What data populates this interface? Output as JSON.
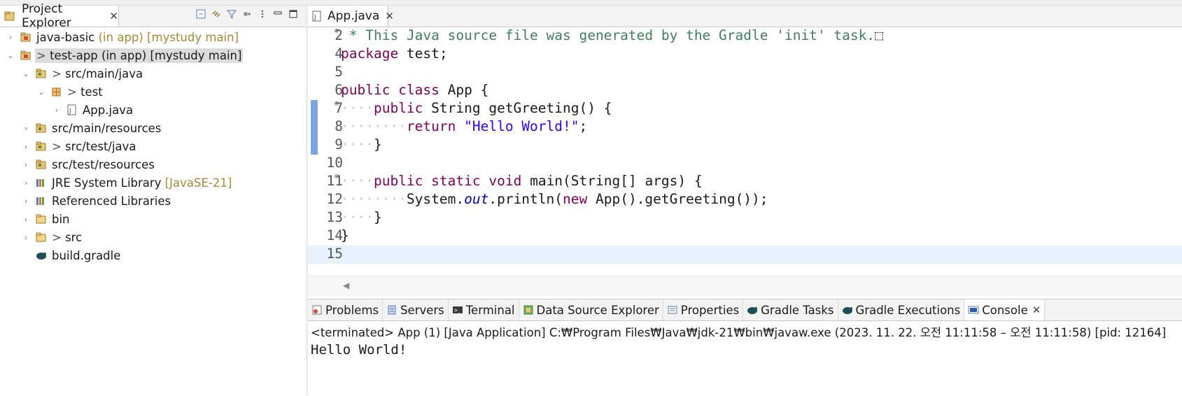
{
  "explorer": {
    "tab_label": "Project Explorer",
    "close": "✕",
    "tools": [
      "collapse-all-icon",
      "link-editor-icon",
      "filter-icon",
      "focus-icon",
      "view-menu-icon",
      "minimize-icon",
      "maximize-icon"
    ],
    "items": [
      {
        "twisty": "›",
        "icon": "project-icon",
        "prefix": "",
        "name": "java-basic",
        "decoration": " (in app) [mystudy main]",
        "selected": false
      },
      {
        "twisty": "⌄",
        "icon": "project-icon",
        "prefix": "> ",
        "name": "test-app (in app) [mystudy main]",
        "decoration": "",
        "selected": true
      },
      {
        "twisty": "⌄",
        "icon": "source-folder-icon",
        "prefix": "> ",
        "name": "src/main/java",
        "decoration": "",
        "selected": false
      },
      {
        "twisty": "⌄",
        "icon": "package-icon",
        "prefix": "> ",
        "name": "test",
        "decoration": "",
        "selected": false
      },
      {
        "twisty": "›",
        "icon": "java-file-icon",
        "prefix": "",
        "name": "App.java",
        "decoration": "",
        "selected": false
      },
      {
        "twisty": "›",
        "icon": "source-folder-icon",
        "prefix": "",
        "name": "src/main/resources",
        "decoration": "",
        "selected": false
      },
      {
        "twisty": "›",
        "icon": "source-folder-icon",
        "prefix": "> ",
        "name": "src/test/java",
        "decoration": "",
        "selected": false
      },
      {
        "twisty": "›",
        "icon": "source-folder-icon",
        "prefix": "",
        "name": "src/test/resources",
        "decoration": "",
        "selected": false
      },
      {
        "twisty": "›",
        "icon": "library-icon",
        "prefix": "",
        "name": "JRE System Library",
        "decoration": " [JavaSE-21]",
        "selected": false
      },
      {
        "twisty": "›",
        "icon": "library-icon",
        "prefix": "",
        "name": "Referenced Libraries",
        "decoration": "",
        "selected": false
      },
      {
        "twisty": "›",
        "icon": "folder-icon",
        "prefix": "",
        "name": "bin",
        "decoration": "",
        "selected": false
      },
      {
        "twisty": "›",
        "icon": "folder-icon",
        "prefix": "> ",
        "name": "src",
        "decoration": "",
        "selected": false
      },
      {
        "twisty": "",
        "icon": "gradle-file-icon",
        "prefix": "",
        "name": "build.gradle",
        "decoration": "",
        "selected": false
      }
    ]
  },
  "editor": {
    "tab_label": "App.java",
    "close": "✕",
    "lines": [
      {
        "n": "2",
        "fold": "⊕",
        "segs": [
          {
            "c": "cm",
            "t": " * This Java source file was generated by the Gradle 'init' task."
          },
          {
            "c": "",
            "t": "⬚"
          }
        ]
      },
      {
        "n": "4",
        "fold": "",
        "segs": [
          {
            "c": "kw",
            "t": "package"
          },
          {
            "c": "",
            "t": " test;"
          }
        ]
      },
      {
        "n": "5",
        "fold": "",
        "segs": []
      },
      {
        "n": "6",
        "fold": "",
        "segs": [
          {
            "c": "kw",
            "t": "public"
          },
          {
            "c": "",
            "t": " "
          },
          {
            "c": "kw",
            "t": "class"
          },
          {
            "c": "",
            "t": " App {"
          }
        ]
      },
      {
        "n": "7",
        "fold": "⊖",
        "segs": [
          {
            "c": "ws",
            "t": "····"
          },
          {
            "c": "kw",
            "t": "public"
          },
          {
            "c": "",
            "t": " String getGreeting() {"
          }
        ]
      },
      {
        "n": "8",
        "fold": "",
        "segs": [
          {
            "c": "ws",
            "t": "········"
          },
          {
            "c": "kw",
            "t": "return"
          },
          {
            "c": "",
            "t": " "
          },
          {
            "c": "str",
            "t": "\"Hello World!\""
          },
          {
            "c": "",
            "t": ";"
          }
        ]
      },
      {
        "n": "9",
        "fold": "",
        "segs": [
          {
            "c": "ws",
            "t": "····"
          },
          {
            "c": "",
            "t": "}"
          }
        ]
      },
      {
        "n": "10",
        "fold": "",
        "segs": []
      },
      {
        "n": "11",
        "fold": "⊖",
        "segs": [
          {
            "c": "ws",
            "t": "····"
          },
          {
            "c": "kw",
            "t": "public"
          },
          {
            "c": "",
            "t": " "
          },
          {
            "c": "kw",
            "t": "static"
          },
          {
            "c": "",
            "t": " "
          },
          {
            "c": "kw",
            "t": "void"
          },
          {
            "c": "",
            "t": " main(String[] args) {"
          }
        ]
      },
      {
        "n": "12",
        "fold": "",
        "segs": [
          {
            "c": "ws",
            "t": "········"
          },
          {
            "c": "",
            "t": "System."
          },
          {
            "c": "fld",
            "t": "out"
          },
          {
            "c": "",
            "t": ".println("
          },
          {
            "c": "kw",
            "t": "new"
          },
          {
            "c": "",
            "t": " App().getGreeting());"
          }
        ]
      },
      {
        "n": "13",
        "fold": "",
        "segs": [
          {
            "c": "ws",
            "t": "····"
          },
          {
            "c": "",
            "t": "}"
          }
        ]
      },
      {
        "n": "14",
        "fold": "",
        "segs": [
          {
            "c": "",
            "t": "}"
          }
        ]
      },
      {
        "n": "15",
        "fold": "",
        "segs": [],
        "current": true
      }
    ],
    "scroll_left": "◀"
  },
  "bottom": {
    "tabs": [
      {
        "label": "Problems",
        "icon": "problems-icon",
        "active": false
      },
      {
        "label": "Servers",
        "icon": "servers-icon",
        "active": false
      },
      {
        "label": "Terminal",
        "icon": "terminal-icon",
        "active": false
      },
      {
        "label": "Data Source Explorer",
        "icon": "data-source-icon",
        "active": false
      },
      {
        "label": "Properties",
        "icon": "properties-icon",
        "active": false
      },
      {
        "label": "Gradle Tasks",
        "icon": "gradle-icon",
        "active": false
      },
      {
        "label": "Gradle Executions",
        "icon": "gradle-icon",
        "active": false
      },
      {
        "label": "Console",
        "icon": "console-icon",
        "active": true
      }
    ],
    "console_info": "<terminated> App (1) [Java Application] C:₩Program Files₩Java₩jdk-21₩bin₩javaw.exe  (2023. 11. 22. 오전 11:11:58 – 오전 11:11:58) [pid: 12164]",
    "console_output": "Hello World!"
  },
  "colors": {
    "keyword": "#7f0055",
    "string": "#2a00ff",
    "comment": "#3f7f5f",
    "field": "#0000c0",
    "decoration": "#a58a36"
  }
}
